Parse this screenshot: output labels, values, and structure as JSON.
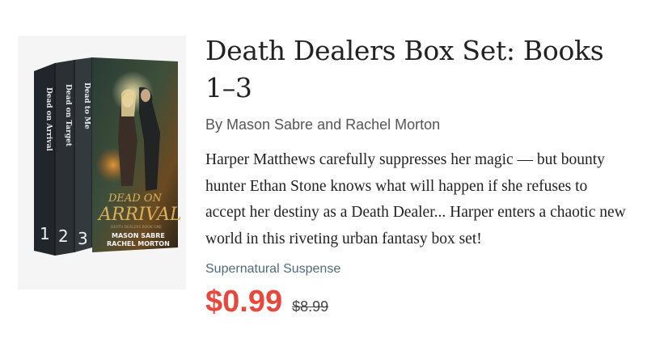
{
  "book": {
    "title": "Death Dealers Box Set: Books 1–3",
    "authors": "By Mason Sabre and Rachel Morton",
    "description": "Harper Matthews carefully suppresses her magic — but bounty hunter Ethan Stone knows what will happen if she refuses to accept her destiny as a Death Dealer... Harper enters a chaotic new world in this riveting urban fantasy box set!",
    "genre": "Supernatural Suspense",
    "price": "$0.99",
    "original_price": "$8.99"
  },
  "cover": {
    "spines": [
      {
        "title": "Dead on Arrival",
        "number": "1"
      },
      {
        "title": "Dead on Target",
        "number": "2"
      },
      {
        "title": "Dead to Me",
        "number": "3"
      }
    ],
    "front_title_line1": "DEAD ON",
    "front_title_line2": "ARRIVAL",
    "front_series": "DEATH DEALERS BOOK ONE",
    "front_author1": "MASON SABRE",
    "front_author2": "RACHEL MORTON"
  },
  "colors": {
    "price": "#e8473b",
    "genre": "#4f6b7b",
    "title_gold": "#d9b15a"
  }
}
